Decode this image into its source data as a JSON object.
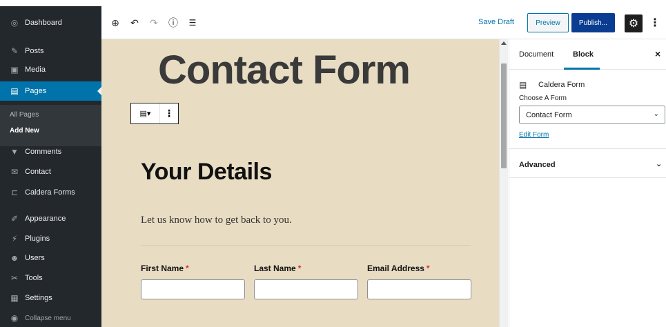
{
  "sidebar": {
    "items": [
      {
        "label": "Dashboard",
        "icon": "dashboard-icon",
        "glyph": "◎"
      },
      {
        "label": "Posts",
        "icon": "pin-icon",
        "glyph": "✎"
      },
      {
        "label": "Media",
        "icon": "media-icon",
        "glyph": "▣"
      },
      {
        "label": "Pages",
        "icon": "pages-icon",
        "glyph": "▤"
      },
      {
        "label": "Comments",
        "icon": "comments-icon",
        "glyph": "▼"
      },
      {
        "label": "Contact",
        "icon": "mail-icon",
        "glyph": "✉"
      },
      {
        "label": "Caldera Forms",
        "icon": "caldera-icon",
        "glyph": "⊏"
      },
      {
        "label": "Appearance",
        "icon": "brush-icon",
        "glyph": "✐"
      },
      {
        "label": "Plugins",
        "icon": "plugin-icon",
        "glyph": "⚡"
      },
      {
        "label": "Users",
        "icon": "user-icon",
        "glyph": "☻"
      },
      {
        "label": "Tools",
        "icon": "wrench-icon",
        "glyph": "✂"
      },
      {
        "label": "Settings",
        "icon": "settings-icon",
        "glyph": "▦"
      },
      {
        "label": "Collapse menu",
        "icon": "collapse-icon",
        "glyph": "◉"
      }
    ],
    "submenu": {
      "all_pages": "All Pages",
      "add_new": "Add New"
    }
  },
  "toolbar": {
    "save_draft": "Save Draft",
    "preview": "Preview",
    "publish": "Publish...",
    "icons": {
      "add": "⊕",
      "undo": "↶",
      "redo": "↷",
      "info": "ⓘ",
      "outline": "☰",
      "gear": "⚙",
      "more": "⋮"
    }
  },
  "canvas": {
    "page_title": "Contact Form",
    "block_toolbar": {
      "type_glyph": "▤▾",
      "more_glyph": "⋮"
    },
    "heading": "Your Details",
    "intro": "Let us know how to get back to you.",
    "fields": [
      {
        "label": "First Name",
        "required": "*"
      },
      {
        "label": "Last Name",
        "required": "*"
      },
      {
        "label": "Email Address",
        "required": "*"
      }
    ]
  },
  "inspector": {
    "tabs": {
      "document": "Document",
      "block": "Block"
    },
    "close": "×",
    "block_name": "Caldera Form",
    "block_glyph": "▤",
    "choose_label": "Choose A Form",
    "selected_form": "Contact Form",
    "select_arrow": "⌄",
    "edit_form": "Edit Form",
    "advanced": "Advanced",
    "advanced_chevron": "⌄"
  },
  "colors": {
    "sidebar_bg": "#23282d",
    "active_blue": "#0073aa",
    "publish_blue": "#0a3d91",
    "canvas_bg": "#e8dcc3",
    "required_red": "#d63638"
  }
}
